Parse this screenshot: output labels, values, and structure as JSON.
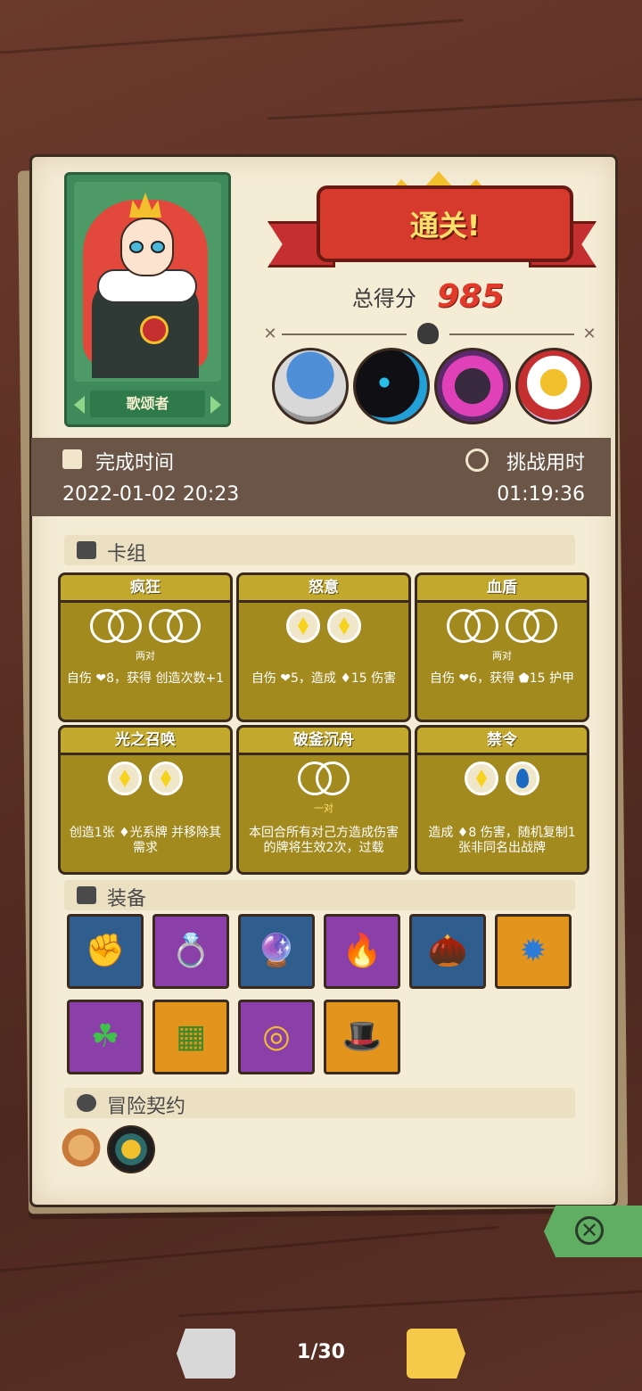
{
  "hero": {
    "name": "歌颂者"
  },
  "result": {
    "title": "通关!",
    "score_label": "总得分",
    "score": "985"
  },
  "bosses": [
    "mushroom-elder",
    "shadow-beast",
    "dark-titan",
    "flame-guardian"
  ],
  "times": {
    "finish_label": "完成时间",
    "finish_value": "2022-01-02 20:23",
    "challenge_label": "挑战用时",
    "challenge_value": "01:19:36"
  },
  "deck": {
    "title": "卡组",
    "cards": [
      {
        "name": "疯狂",
        "slots": [
          "empty",
          "empty"
        ],
        "sub": "两对",
        "desc": "自伤 ❤8，获得 创造次数+1"
      },
      {
        "name": "怒意",
        "slots": [
          "diamond",
          "diamond"
        ],
        "sub": "",
        "desc": "自伤 ❤5，造成 ♦15 伤害"
      },
      {
        "name": "血盾",
        "slots": [
          "empty",
          "empty"
        ],
        "sub": "两对",
        "desc": "自伤 ❤6，获得 ⬟15 护甲"
      },
      {
        "name": "光之召唤",
        "slots": [
          "diamond",
          "diamond"
        ],
        "sub": "",
        "desc": "创造1张 ♦光系牌 并移除其需求"
      },
      {
        "name": "破釜沉舟",
        "slots": [
          "empty"
        ],
        "sub": "一对",
        "desc": "本回合所有对己方造成伤害的牌将生效2次，过载"
      },
      {
        "name": "禁令",
        "slots": [
          "diamond",
          "drop"
        ],
        "sub": "",
        "desc": "造成 ♦8 伤害，随机复制1张非同名出战牌"
      }
    ]
  },
  "equipment": {
    "title": "装备",
    "items": [
      {
        "icon": "gauntlet",
        "glyph": "✊",
        "bg": "#2f5d8e"
      },
      {
        "icon": "leaf-ring",
        "glyph": "💍",
        "bg": "#8b3fa8"
      },
      {
        "icon": "star-orb",
        "glyph": "🔮",
        "bg": "#2f5d8e"
      },
      {
        "icon": "fire-potion",
        "glyph": "🔥",
        "bg": "#8b3fa8"
      },
      {
        "icon": "seed-pouch",
        "glyph": "🌰",
        "bg": "#2f5d8e"
      },
      {
        "icon": "spiked-orb",
        "glyph": "✹",
        "bg": "#e2941c"
      },
      {
        "icon": "four-leaf-clover",
        "glyph": "☘",
        "bg": "#8b3fa8"
      },
      {
        "icon": "moss-tablet",
        "glyph": "▦",
        "bg": "#e2941c"
      },
      {
        "icon": "golden-shield",
        "glyph": "◎",
        "bg": "#8b3fa8"
      },
      {
        "icon": "purple-hat",
        "glyph": "🎩",
        "bg": "#e2941c"
      }
    ]
  },
  "contracts": {
    "title": "冒险契约",
    "items": [
      "scroll-icon",
      "golden-cube-icon"
    ]
  },
  "pager": {
    "text": "1/30"
  }
}
